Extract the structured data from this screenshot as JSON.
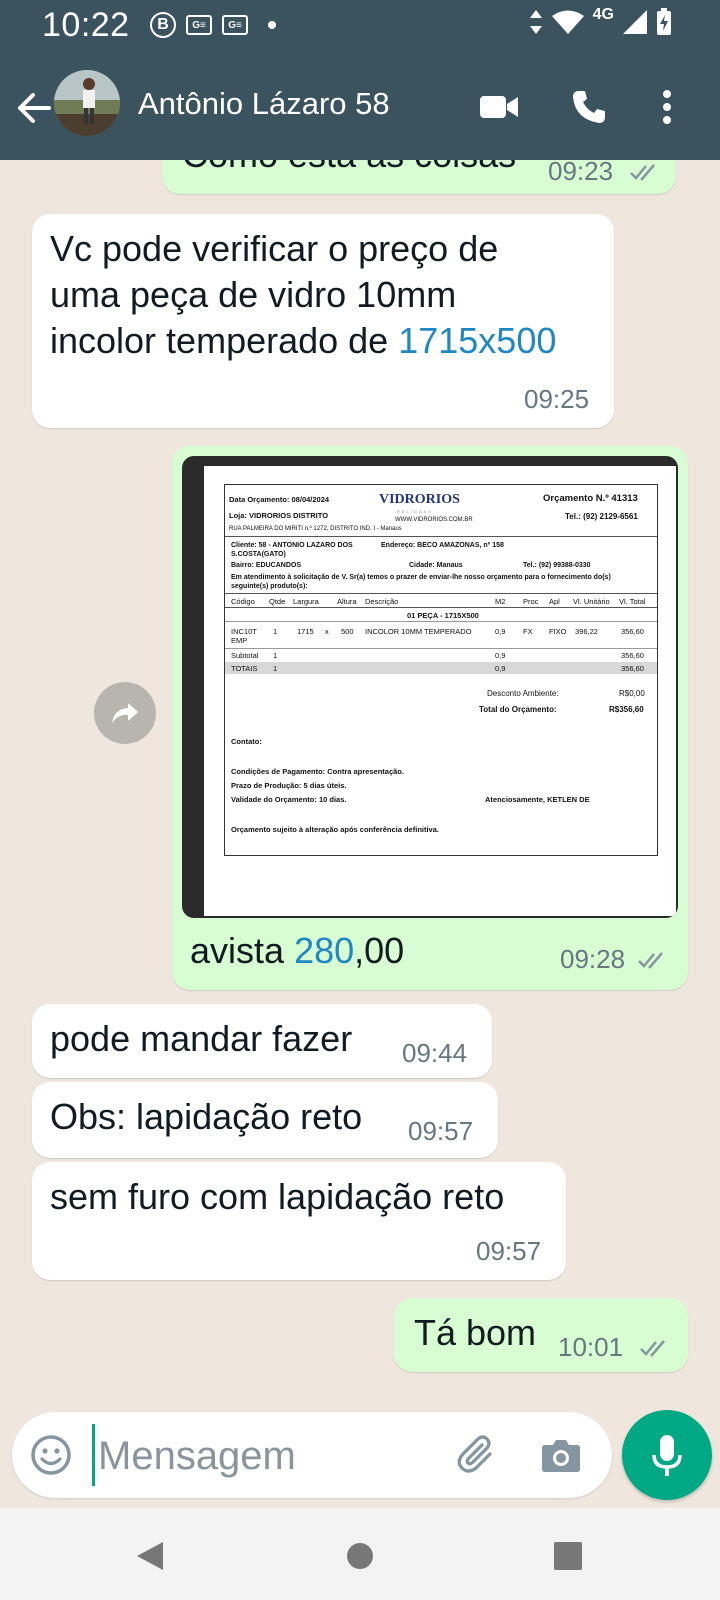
{
  "status_bar": {
    "time": "10:22",
    "network": "4G",
    "icons": [
      "b-badge-icon",
      "gm-icon",
      "gm-icon",
      "dot-icon",
      "data-arrows-icon",
      "wifi-icon",
      "signal-icon",
      "battery-charging-icon"
    ]
  },
  "header": {
    "contact_name": "Antônio Lázaro 58",
    "icons": [
      "back-arrow-icon",
      "video-call-icon",
      "phone-call-icon",
      "more-vert-icon"
    ]
  },
  "messages": [
    {
      "dir": "out",
      "text": "Como está as coisas",
      "time": "09:23",
      "read": true,
      "partially_visible": true
    },
    {
      "dir": "in",
      "text_plain": "Vc pode verificar o preço de uma peça de vidro 10mm incolor temperado de",
      "text_link": "1715x500",
      "time": "09:25"
    },
    {
      "dir": "out",
      "type": "image",
      "caption_plain": "avista",
      "caption_link": "280",
      "caption_rest": ",00",
      "time": "09:28",
      "read": true
    },
    {
      "dir": "in",
      "text": "pode mandar fazer",
      "time": "09:44"
    },
    {
      "dir": "in",
      "text": "Obs: lapidação reto",
      "time": "09:57"
    },
    {
      "dir": "in",
      "text": "sem furo com lapidação reto",
      "time": "09:57"
    },
    {
      "dir": "out",
      "text": "Tá bom",
      "time": "10:01",
      "read": true
    }
  ],
  "quote": {
    "date": "Data Orçamento: 08/04/2024",
    "logo": "VIDRORIOS",
    "logo_sub": "RELIGAAS",
    "number": "Orçamento N.º 41313",
    "store": "Loja: VIDRORIOS DISTRITO",
    "website": "WWW.VIDRORIOS.COM.BR",
    "phone": "Tel.: (92) 2129-6561",
    "address": "RUA PALMEIRA DO MIRITI n.º 1272, DISTRITO IND. I - Manaus",
    "client": "Cliente: 58 - ANTONIO LAZARO DOS S.COSTA(GATO)",
    "client_address": "Endereço: BECO AMAZONAS, nº 158",
    "neighborhood": "Bairro: EDUCANDOS",
    "city": "Cidade: Manaus",
    "client_phone": "Tel.: (92) 99388-0330",
    "intro": "Em atendimento à solicitação de V. Sr(a) temos o prazer de enviar-lhe nosso orçamento para o fornecimento do(s) seguinte(s) produto(s):",
    "columns": [
      "Código",
      "Qtde",
      "Largura",
      "Altura",
      "Descrição",
      "M2",
      "Proc",
      "Apl",
      "Vl. Unitário",
      "Vl. Total"
    ],
    "section": "01 PEÇA - 1715X500",
    "row": {
      "code": "INC10T EMP",
      "qty": "1",
      "width": "1715",
      "x": "x",
      "height": "500",
      "desc": "INCOLOR 10MM TEMPERADO",
      "m2": "0,9",
      "proc": "FX",
      "apl": "FIXO",
      "unit": "396,22",
      "total": "356,60"
    },
    "subtotal": {
      "label": "Subtotal",
      "qty": "1",
      "m2": "0,9",
      "total": "356,60"
    },
    "totals": {
      "label": "TOTAIS",
      "qty": "1",
      "m2": "0,9",
      "total": "356,60"
    },
    "discount_label": "Desconto Ambiente:",
    "discount_value": "R$0,00",
    "grand_total_label": "Total do Orçamento:",
    "grand_total_value": "R$356,60",
    "contact": "Contato:",
    "payment": "Condições de Pagamento: Contra apresentação.",
    "production": "Prazo de Produção: 5 dias úteis.",
    "validity": "Validade do Orçamento: 10 dias.",
    "signature": "Atenciosamente, KETLEN DE",
    "note": "Orçamento sujeito à alteração após conferência definitiva."
  },
  "input": {
    "placeholder": "Mensagem",
    "icons": [
      "emoji-icon",
      "attach-icon",
      "camera-icon",
      "mic-icon"
    ]
  },
  "colors": {
    "header": "#3b535e",
    "outgoing_bubble": "#d9fdd3",
    "incoming_bubble": "#ffffff",
    "chat_bg": "#efe7de",
    "accent": "#00a884",
    "link": "#1f88c2"
  }
}
